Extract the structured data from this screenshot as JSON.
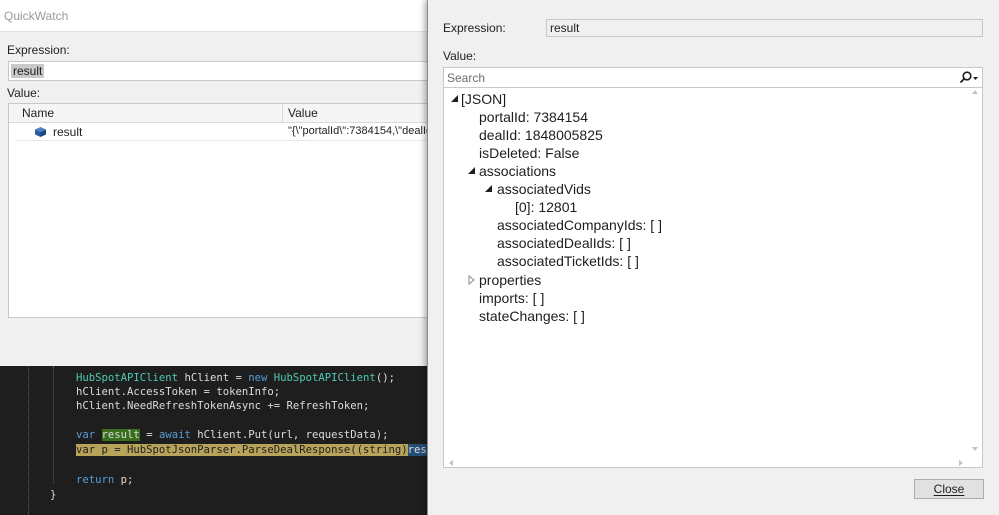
{
  "quickwatch": {
    "title": "QuickWatch",
    "expression_label": "Expression:",
    "expression_value": "result",
    "value_label": "Value:",
    "columns": {
      "name": "Name",
      "value": "Value"
    },
    "row": {
      "name": "result",
      "value": "\"{\\\"portalId\\\":7384154,\\\"dealId"
    }
  },
  "editor": {
    "line1_type": "HubSpotAPIClient",
    "line1_rest": " hClient = ",
    "line1_kw": "new",
    "line1_type2": " HubSpotAPIClient",
    "line1_end": "();",
    "line2": "hClient.AccessToken = tokenInfo;",
    "line3": "hClient.NeedRefreshTokenAsync += RefreshToken;",
    "line4_kw": "var",
    "line4_var": "result",
    "line4_eq": " = ",
    "line4_kw2": "await",
    "line4_rest": " hClient.Put(url, requestData);",
    "line5_main": "var p = HubSpotJsonParser.ParseDealResponse((string)",
    "line5_sel": "res",
    "line6_kw": "return",
    "line6_rest": " p;",
    "brace": "}"
  },
  "visualizer": {
    "expression_label": "Expression:",
    "expression_value": "result",
    "value_label": "Value:",
    "search_placeholder": "Search",
    "close_label": "Close",
    "tree": {
      "root": "[JSON]",
      "portalId": "portalId: 7384154",
      "dealId": "dealId: 1848005825",
      "isDeleted": "isDeleted: False",
      "associations": "associations",
      "associatedVids": "associatedVids",
      "vid0": "[0]: 12801",
      "associatedCompanyIds": "associatedCompanyIds: [ ]",
      "associatedDealIds": "associatedDealIds: [ ]",
      "associatedTicketIds": "associatedTicketIds: [ ]",
      "properties": "properties",
      "imports": "imports: [ ]",
      "stateChanges": "stateChanges: [ ]"
    }
  }
}
